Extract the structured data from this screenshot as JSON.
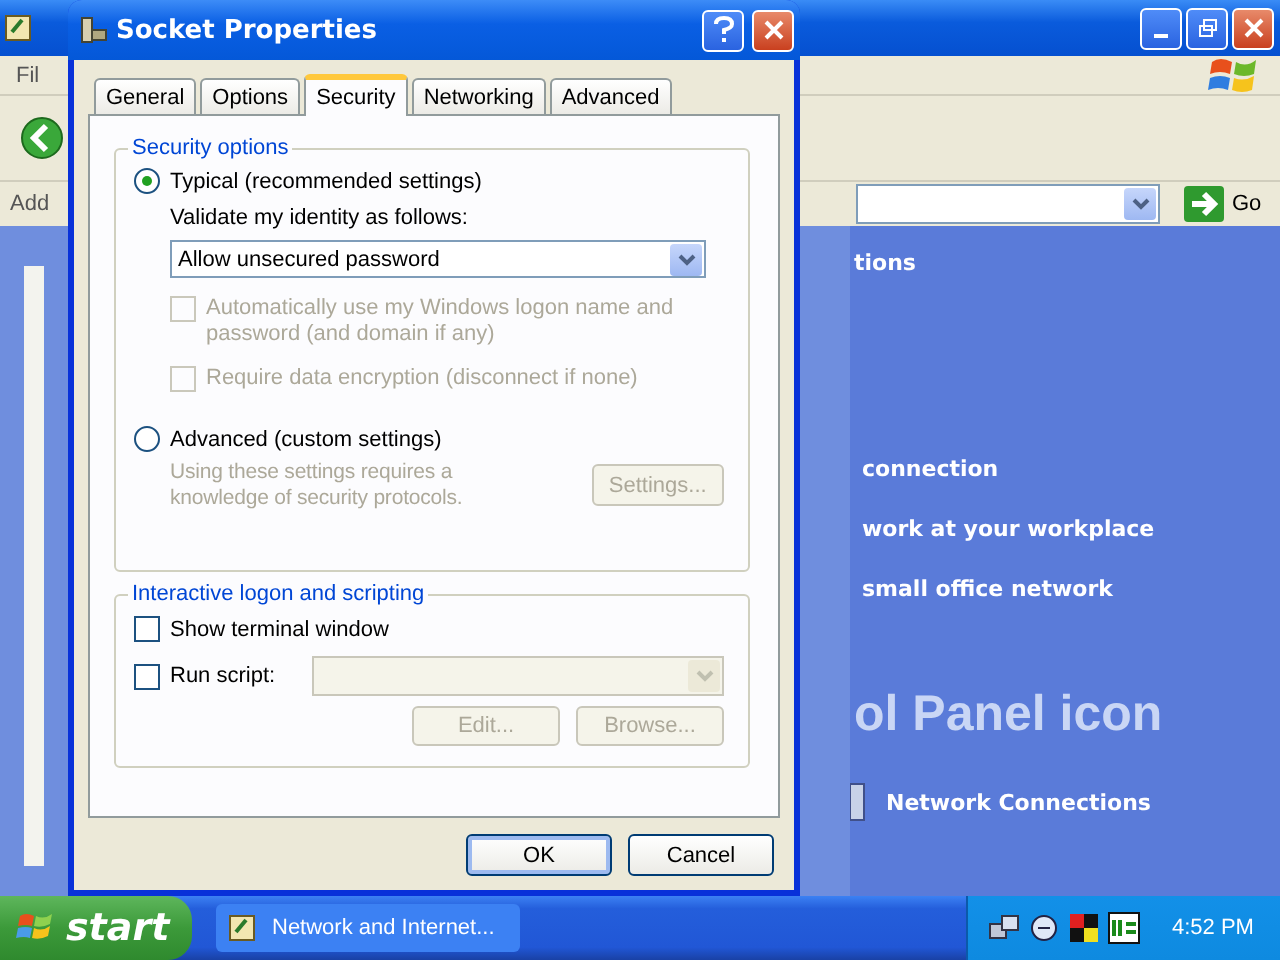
{
  "explorer": {
    "menu_partial": "Fil",
    "address_label": "Add",
    "go_button": "Go",
    "content_items": [
      {
        "kind": "heading",
        "text": "tions"
      },
      {
        "kind": "link",
        "text": "connection"
      },
      {
        "kind": "link",
        "text": "work at your workplace"
      },
      {
        "kind": "link",
        "text": "small office network"
      },
      {
        "kind": "banner",
        "text": "ol Panel icon"
      },
      {
        "kind": "icon_link",
        "text": "Network Connections"
      }
    ]
  },
  "dialog": {
    "title": "Socket Properties",
    "tabs": [
      {
        "label": "General",
        "selected": false
      },
      {
        "label": "Options",
        "selected": false
      },
      {
        "label": "Security",
        "selected": true
      },
      {
        "label": "Networking",
        "selected": false
      },
      {
        "label": "Advanced",
        "selected": false
      }
    ],
    "security_group": {
      "title": "Security options",
      "options": [
        {
          "label": "Typical (recommended settings)",
          "selected": true
        },
        {
          "label": "Advanced (custom settings)",
          "selected": false
        }
      ],
      "validate_label": "Validate my identity as follows:",
      "identity_select": {
        "value": "Allow unsecured password"
      },
      "checkboxes": [
        {
          "label": "Automatically use my Windows logon name and password (and domain if any)",
          "checked": false,
          "disabled": true
        },
        {
          "label": "Require data encryption (disconnect if none)",
          "checked": false,
          "disabled": true
        }
      ],
      "advanced_note": {
        "text": "Using these settings requires a knowledge of security protocols.",
        "disabled": true
      },
      "settings_button": {
        "label": "Settings...",
        "disabled": true
      }
    },
    "scripting_group": {
      "title": "Interactive logon and scripting",
      "checkboxes": [
        {
          "label": "Show terminal window",
          "checked": false,
          "disabled": false
        },
        {
          "label": "Run script:",
          "checked": false,
          "disabled": false
        }
      ],
      "script_select": {
        "disabled": true
      },
      "buttons": [
        {
          "label": "Edit...",
          "disabled": true
        },
        {
          "label": "Browse...",
          "disabled": true
        }
      ]
    },
    "buttons": [
      {
        "label": "OK",
        "default": true
      },
      {
        "label": "Cancel",
        "default": false
      }
    ]
  },
  "taskbar": {
    "start": "start",
    "tasks": [
      {
        "label": "Network and Internet...",
        "selected": false
      }
    ],
    "clock": "4:52 PM"
  }
}
